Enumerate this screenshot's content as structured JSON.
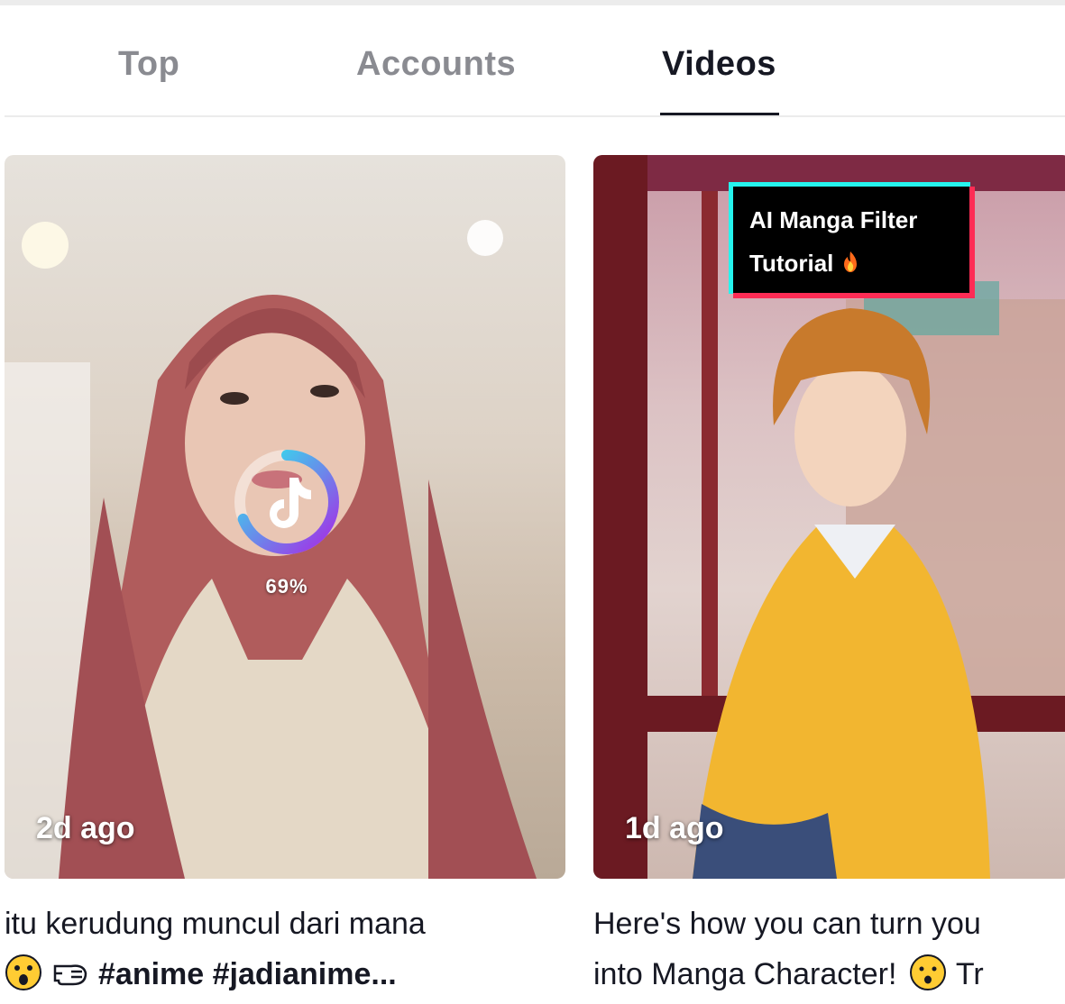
{
  "tabs": [
    {
      "label": "Top"
    },
    {
      "label": "Accounts"
    },
    {
      "label": "Videos"
    }
  ],
  "active_tab": "Videos",
  "videos": [
    {
      "timestamp": "2d ago",
      "loading_percent": "69%",
      "loading_progress": 0.69,
      "caption_line1": "itu kerudung muncul dari mana",
      "caption_emojis": [
        "astonished-face",
        "fist-punch"
      ],
      "hashtags": [
        "#anime",
        "#jadianime..."
      ]
    },
    {
      "timestamp": "1d ago",
      "overlay_text_line1": "AI Manga Filter",
      "overlay_text_line2": "Tutorial",
      "overlay_emoji": "fire",
      "caption_line1": "Here's how you can turn you",
      "caption_line2_text": "into Manga Character!",
      "caption_line2_emoji": "hushed-face",
      "caption_line2_tail": "Tr"
    }
  ],
  "colors": {
    "accent_red": "#fe2c55",
    "accent_cyan": "#25f4ee",
    "text_primary": "#161823",
    "text_muted": "#8a8b91"
  }
}
